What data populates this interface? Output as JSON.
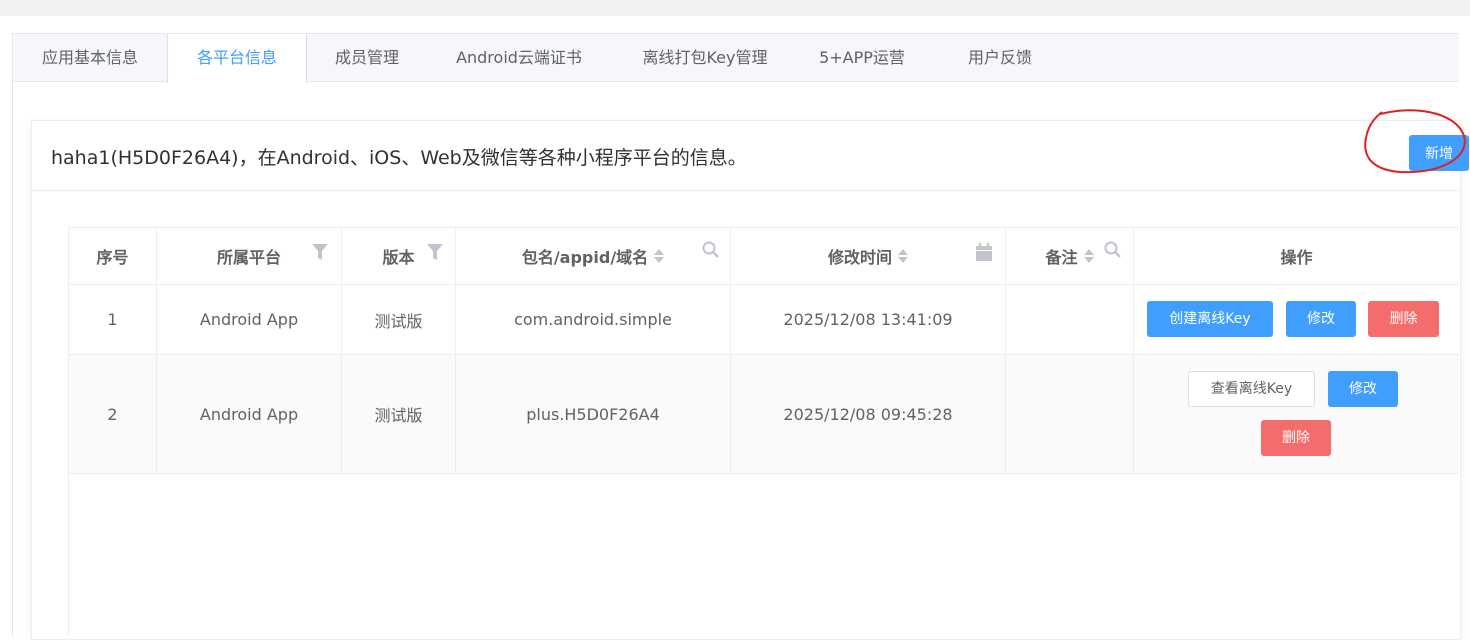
{
  "tabs": [
    {
      "label": "应用基本信息"
    },
    {
      "label": "各平台信息"
    },
    {
      "label": "成员管理"
    },
    {
      "label": "Android云端证书"
    },
    {
      "label": "离线打包Key管理"
    },
    {
      "label": "5+APP运营"
    },
    {
      "label": "用户反馈"
    }
  ],
  "active_tab": "各平台信息",
  "card": {
    "title": "haha1(H5D0F26A4)，在Android、iOS、Web及微信等各种小程序平台的信息。",
    "add_button": "新增"
  },
  "table": {
    "columns": [
      "序号",
      "所属平台",
      "版本",
      "包名/appid/域名",
      "修改时间",
      "备注",
      "操作"
    ],
    "rows": [
      {
        "index": "1",
        "platform": "Android App",
        "version": "测试版",
        "package": "com.android.simple",
        "modified": "2025/12/08 13:41:09",
        "note": "",
        "actions": {
          "key": "创建离线Key",
          "edit": "修改",
          "delete": "删除"
        }
      },
      {
        "index": "2",
        "platform": "Android App",
        "version": "测试版",
        "package": "plus.H5D0F26A4",
        "modified": "2025/12/08 09:45:28",
        "note": "",
        "actions": {
          "key": "查看离线Key",
          "edit": "修改",
          "delete": "删除"
        }
      }
    ]
  },
  "colors": {
    "primary": "#409eff",
    "danger": "#f56c6c",
    "annotation": "#e02020"
  },
  "icons": [
    "filter-icon",
    "search-icon",
    "calendar-icon",
    "sort-icon"
  ]
}
